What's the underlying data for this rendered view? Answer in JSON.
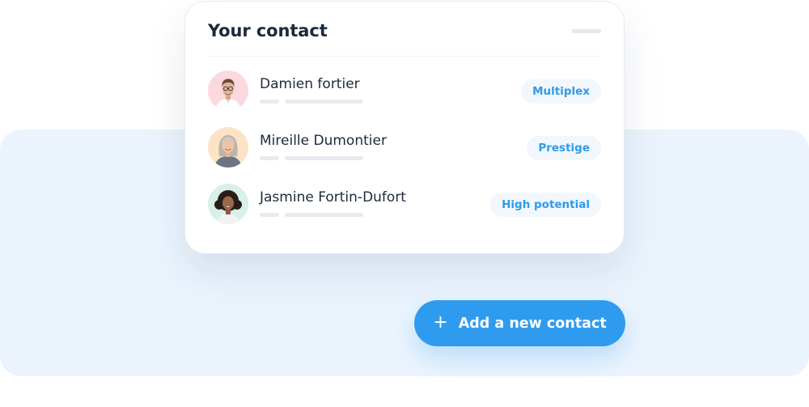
{
  "card": {
    "title": "Your contact"
  },
  "contacts": [
    {
      "name": "Damien fortier",
      "tag": "Multiplex",
      "avatar": "avatar-man-glasses",
      "avatar_bg": "#fbd9df"
    },
    {
      "name": "Mireille Dumontier",
      "tag": "Prestige",
      "avatar": "avatar-woman-gray-hair",
      "avatar_bg": "#fde3c6"
    },
    {
      "name": "Jasmine Fortin-Dufort",
      "tag": "High potential",
      "avatar": "avatar-woman-curly-hair",
      "avatar_bg": "#d8f0ea"
    }
  ],
  "add_button": {
    "icon": "plus-icon",
    "icon_glyph": "+",
    "label": "Add a new contact"
  },
  "colors": {
    "accent": "#2e9bef",
    "tag_text": "#2f9be6",
    "tag_bg": "#f1f7fd",
    "backdrop": "#ebf4fd",
    "heading": "#1c2a3c"
  }
}
